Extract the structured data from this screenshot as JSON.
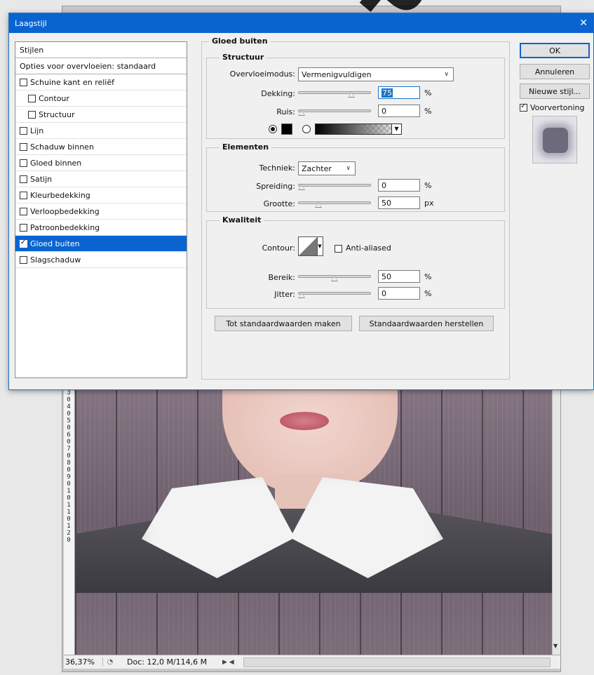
{
  "dialog": {
    "title": "Laagstijl",
    "close_glyph": "✕"
  },
  "styles": {
    "header": "Stijlen",
    "blend_options": "Opties voor overvloeien: standaard",
    "items": [
      {
        "label": "Schuine kant en reliëf",
        "checked": false,
        "indent": false
      },
      {
        "label": "Contour",
        "checked": false,
        "indent": true
      },
      {
        "label": "Structuur",
        "checked": false,
        "indent": true
      },
      {
        "label": "Lijn",
        "checked": false,
        "indent": false
      },
      {
        "label": "Schaduw binnen",
        "checked": false,
        "indent": false
      },
      {
        "label": "Gloed binnen",
        "checked": false,
        "indent": false
      },
      {
        "label": "Satijn",
        "checked": false,
        "indent": false
      },
      {
        "label": "Kleurbedekking",
        "checked": false,
        "indent": false
      },
      {
        "label": "Verloopbedekking",
        "checked": false,
        "indent": false
      },
      {
        "label": "Patroonbedekking",
        "checked": false,
        "indent": false
      },
      {
        "label": "Gloed buiten",
        "checked": true,
        "indent": false,
        "selected": true
      },
      {
        "label": "Slagschaduw",
        "checked": false,
        "indent": false
      }
    ]
  },
  "panel": {
    "title": "Gloed buiten",
    "structure": {
      "title": "Structuur",
      "blend_mode_label": "Overvloeimodus:",
      "blend_mode_value": "Vermenigvuldigen",
      "opacity_label": "Dekking:",
      "opacity_value": "75",
      "opacity_unit": "%",
      "opacity_fraction": 0.75,
      "noise_label": "Ruis:",
      "noise_value": "0",
      "noise_unit": "%",
      "noise_fraction": 0.0,
      "color_mode": "solid",
      "solid_color": "#000000"
    },
    "elements": {
      "title": "Elementen",
      "technique_label": "Techniek:",
      "technique_value": "Zachter",
      "spread_label": "Spreiding:",
      "spread_value": "0",
      "spread_unit": "%",
      "spread_fraction": 0.0,
      "size_label": "Grootte:",
      "size_value": "50",
      "size_unit": "px",
      "size_fraction": 0.25
    },
    "quality": {
      "title": "Kwaliteit",
      "contour_label": "Contour:",
      "anti_aliased_label": "Anti-aliased",
      "anti_aliased": false,
      "range_label": "Bereik:",
      "range_value": "50",
      "range_unit": "%",
      "range_fraction": 0.5,
      "jitter_label": "Jitter:",
      "jitter_value": "0",
      "jitter_unit": "%",
      "jitter_fraction": 0.0
    },
    "make_default": "Tot standaardwaarden maken",
    "reset_default": "Standaardwaarden herstellen"
  },
  "buttons": {
    "ok": "OK",
    "cancel": "Annuleren",
    "new_style": "Nieuwe stijl...",
    "preview_label": "Voorvertoning",
    "preview_checked": true
  },
  "document": {
    "zoom": "36,37%",
    "doc_info": "Doc: 12,0 M/114,6 M",
    "ruler_ticks": [
      "3",
      "0",
      "4",
      "0",
      "5",
      "0",
      "6",
      "0",
      "7",
      "0",
      "8",
      "0",
      "9",
      "0",
      "1",
      "0",
      "1",
      "1",
      "0",
      "1",
      "2",
      "0"
    ]
  },
  "colors": {
    "accent": "#0a64d0",
    "selection": "#0a64d0"
  }
}
